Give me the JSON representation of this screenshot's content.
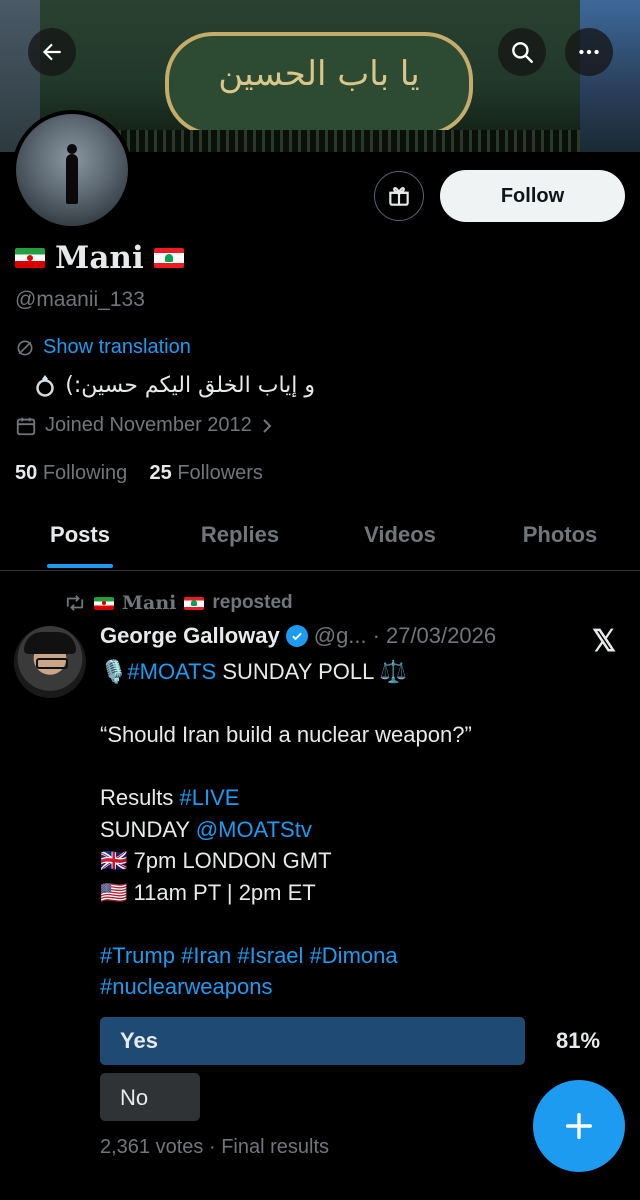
{
  "profile": {
    "name": "Mani",
    "handle": "@maanii_133",
    "show_translation": "Show translation",
    "bio": "و إياب الخلق اليكم حسين:)",
    "joined": "Joined November 2012",
    "following_count": "50",
    "following_label": "Following",
    "followers_count": "25",
    "followers_label": "Followers",
    "follow_button": "Follow"
  },
  "banner": {
    "calligraphy": "يا باب الحسين"
  },
  "tabs": [
    {
      "label": "Posts",
      "active": true
    },
    {
      "label": "Replies",
      "active": false
    },
    {
      "label": "Videos",
      "active": false
    },
    {
      "label": "Photos",
      "active": false
    }
  ],
  "post": {
    "repost_name": "Mani",
    "repost_suffix": "reposted",
    "author": "George Galloway",
    "handle_short": "@g...",
    "date": "27/03/2026",
    "poll_title_tag": "#MOATS",
    "poll_title_rest": " SUNDAY POLL ",
    "question": "“Should Iran build a nuclear weapon?”",
    "results_prefix": "Results ",
    "results_tag": "#LIVE",
    "sunday_prefix": "SUNDAY ",
    "sunday_mention": "@MOATStv",
    "london_time": "7pm LONDON GMT",
    "us_time": "11am PT | 2pm ET",
    "hashtags_line1": [
      "#Trump",
      "#Iran",
      "#Israel",
      "#Dimona"
    ],
    "hashtags_line2": "#nuclearweapons",
    "poll": {
      "options": [
        {
          "label": "Yes",
          "percent": "81%",
          "share": 0.81
        },
        {
          "label": "No",
          "percent": "",
          "share": null
        }
      ],
      "votes": "2,361 votes",
      "status": "Final results"
    }
  },
  "colors": {
    "accent": "#1d9bf0",
    "background": "#000000",
    "muted": "#71767b",
    "poll_winner": "#1f4a73"
  }
}
